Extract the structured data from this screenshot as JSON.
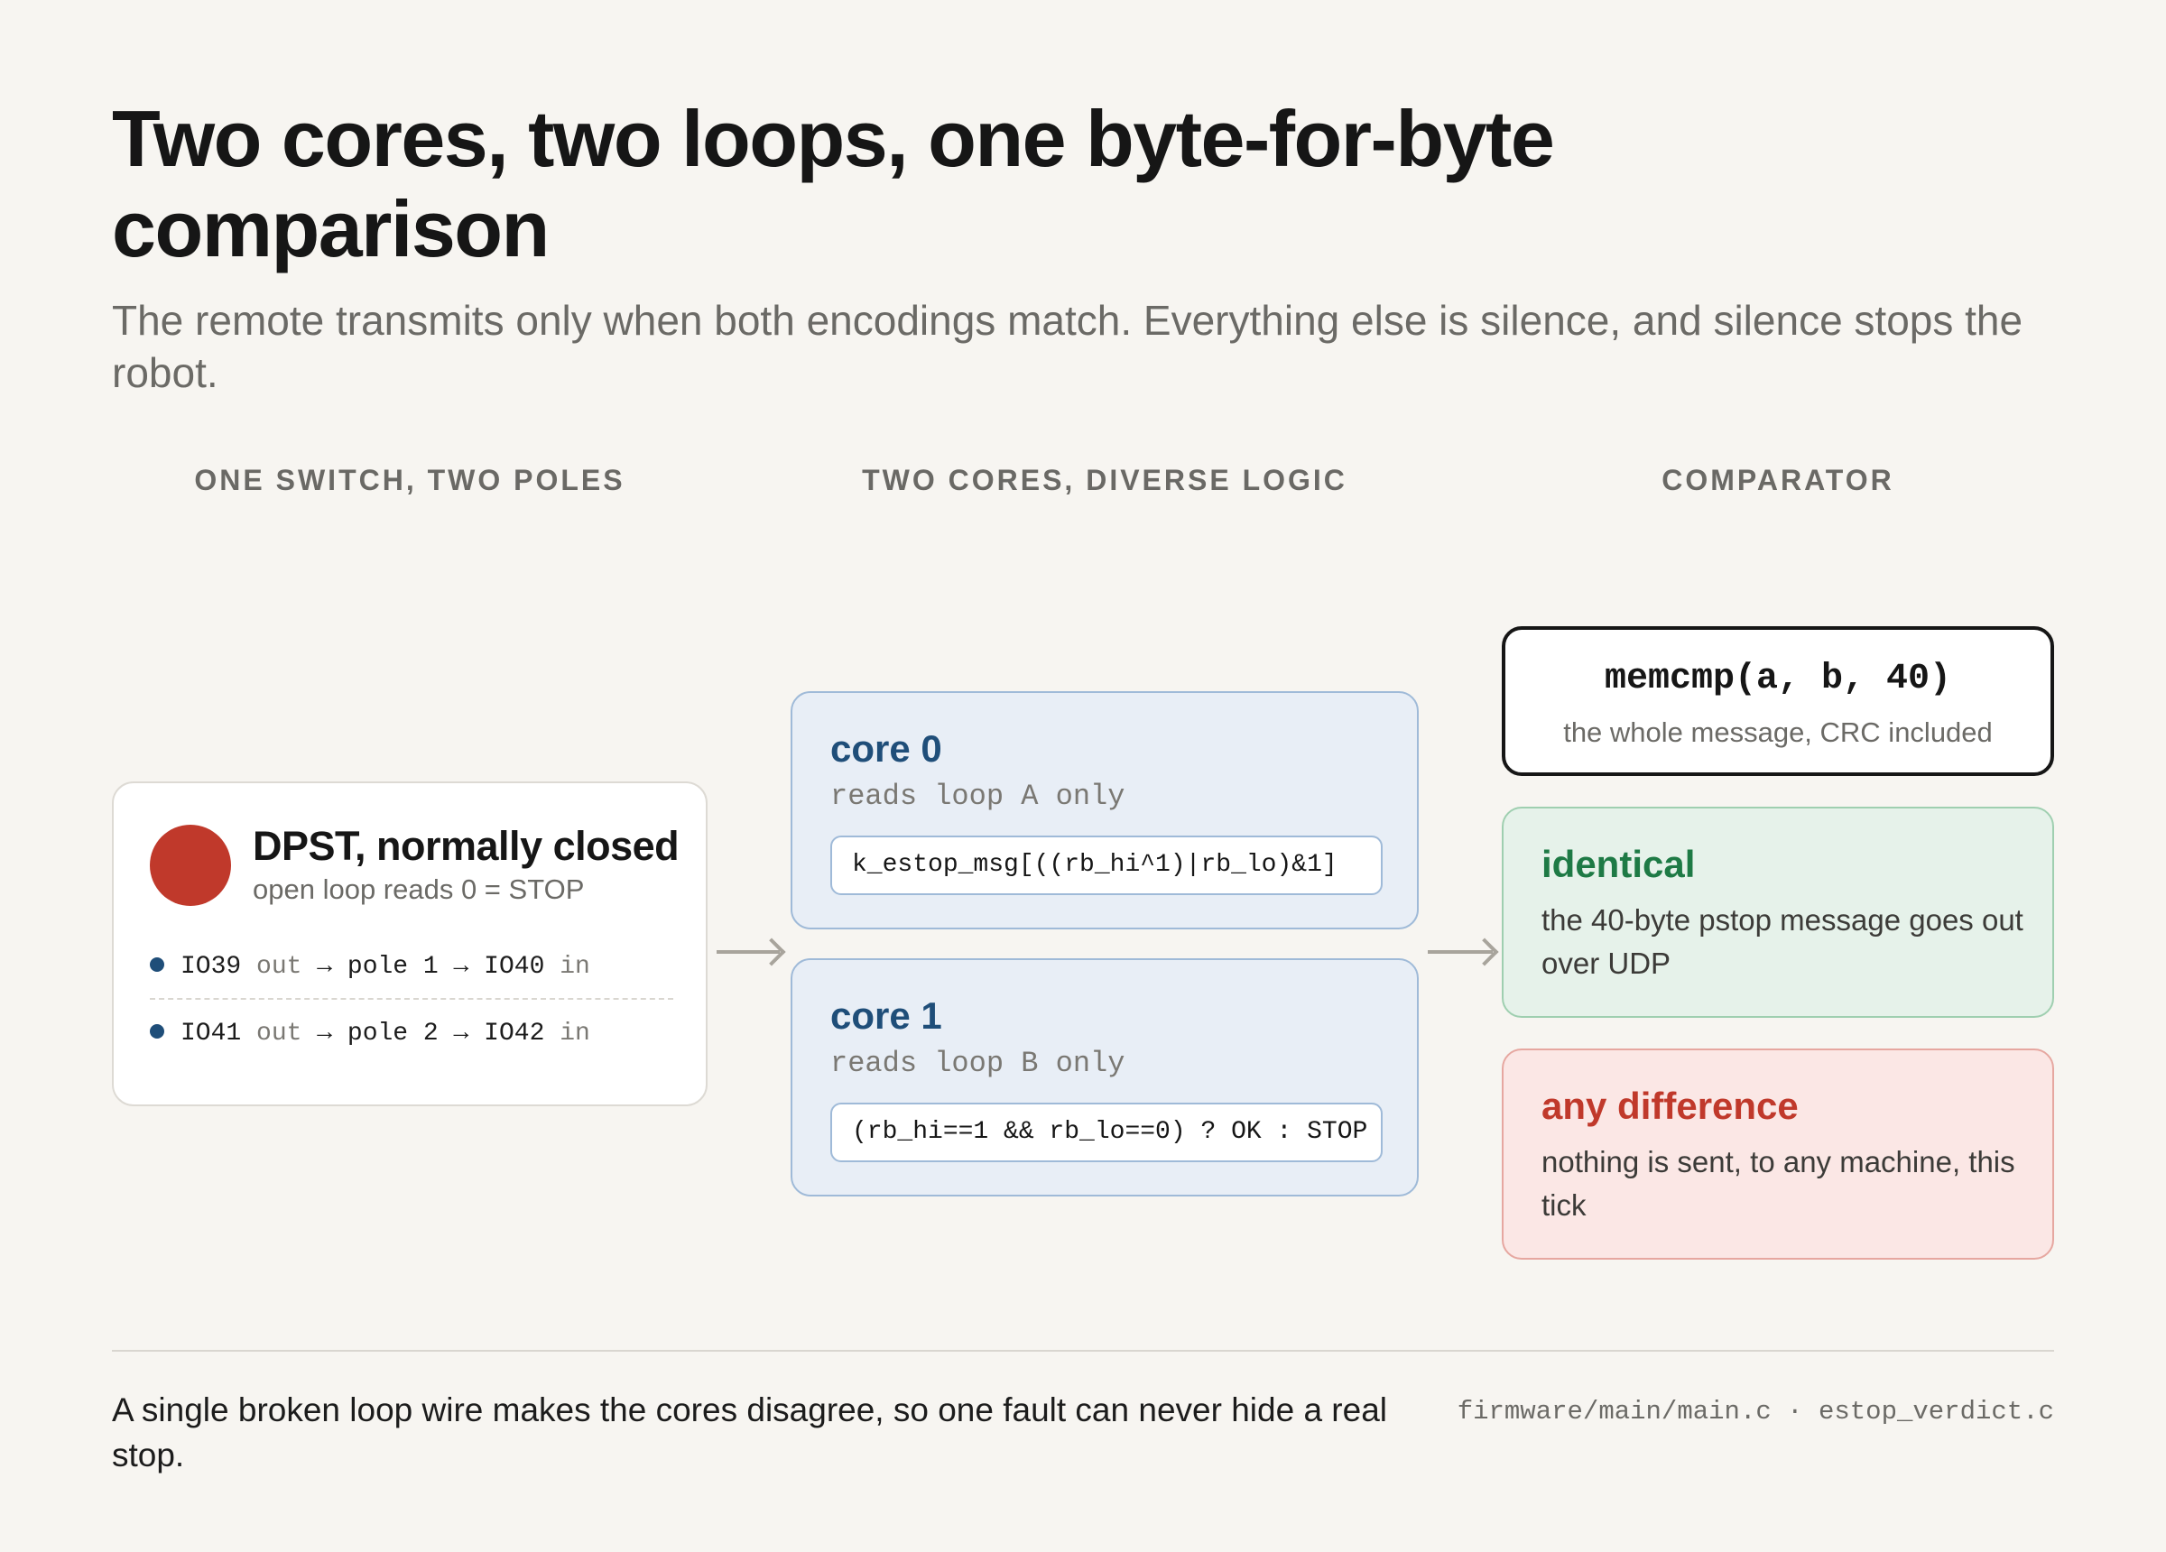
{
  "header": {
    "title": "Two cores, two loops, one byte-for-byte comparison",
    "subtitle": "The remote transmits only when both encodings match. Everything else is silence, and silence stops the robot."
  },
  "columns": {
    "switch": "ONE SWITCH, TWO POLES",
    "cores": "TWO CORES, DIVERSE LOGIC",
    "comparator": "COMPARATOR"
  },
  "switch": {
    "title": "DPST, normally closed",
    "subtitle": "open loop reads 0 = STOP",
    "indicator_color": "#c0392b",
    "poles": [
      {
        "out_pin": "IO39",
        "out_label": "out",
        "arrow": "→",
        "pole": "pole 1",
        "in_pin": "IO40",
        "in_label": "in"
      },
      {
        "out_pin": "IO41",
        "out_label": "out",
        "arrow": "→",
        "pole": "pole 2",
        "in_pin": "IO42",
        "in_label": "in"
      }
    ]
  },
  "cores": [
    {
      "title": "core 0",
      "subtitle": "reads loop A only",
      "code": "k_estop_msg[((rb_hi^1)|rb_lo)&1]"
    },
    {
      "title": "core 1",
      "subtitle": "reads loop B only",
      "code": "(rb_hi==1 && rb_lo==0) ? OK : STOP"
    }
  ],
  "comparator": {
    "code": "memcmp(a, b, 40)",
    "subtitle": "the whole message, CRC included",
    "identical": {
      "title": "identical",
      "text": "the 40-byte pstop message goes out over UDP",
      "color": "#1e7a45"
    },
    "difference": {
      "title": "any difference",
      "text": "nothing is sent, to any machine, this tick",
      "color": "#c0392b"
    }
  },
  "footer": {
    "note": "A single broken loop wire makes the cores disagree, so one fault can never hide a real stop.",
    "files": "firmware/main/main.c · estop_verdict.c"
  }
}
